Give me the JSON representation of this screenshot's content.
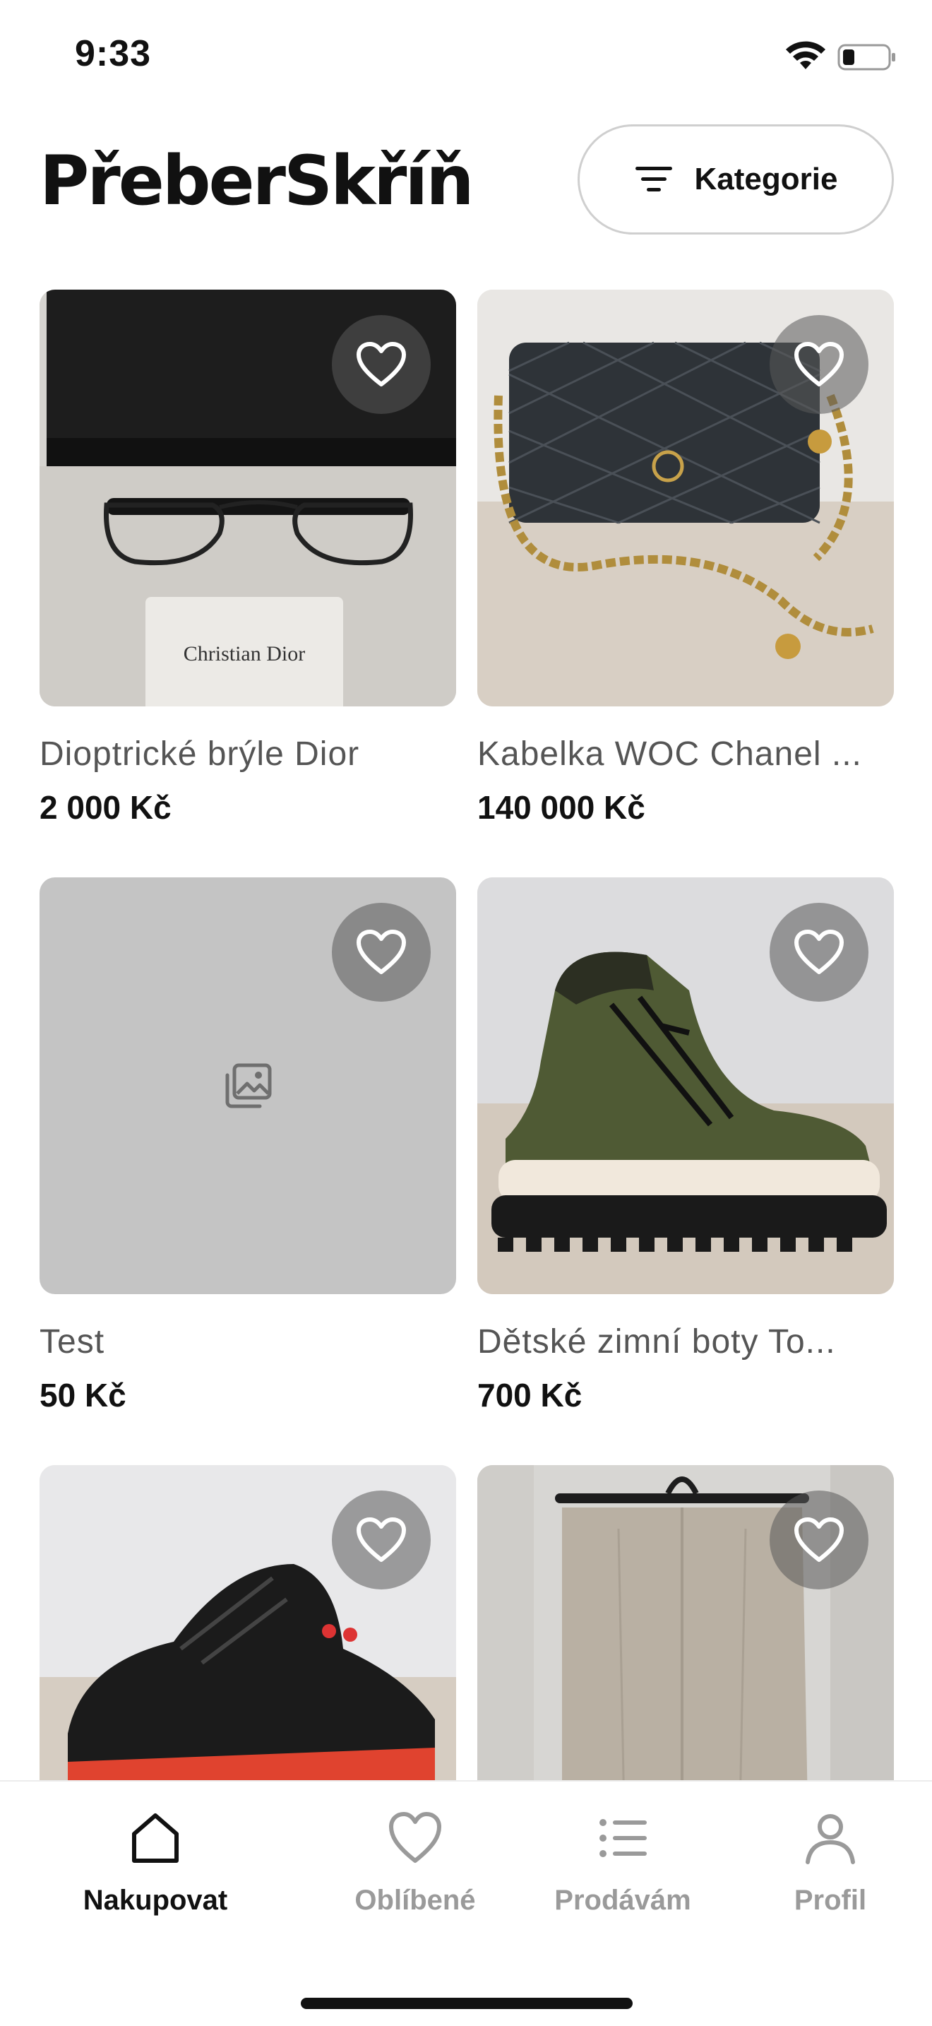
{
  "status_bar": {
    "time": "9:33",
    "wifi_icon": "wifi-icon",
    "battery_icon": "battery-low-icon"
  },
  "header": {
    "logo": "PřeberSkříň",
    "category_button": {
      "label": "Kategorie",
      "icon": "filter-icon"
    }
  },
  "products": [
    {
      "title": "Dioptrické brýle Dior",
      "price": "2 000 Kč",
      "image": "dior-glasses-photo"
    },
    {
      "title": "Kabelka WOC Chanel ...",
      "price": "140 000 Kč",
      "image": "chanel-bag-photo"
    },
    {
      "title": "Test",
      "price": "50 Kč",
      "image": "image-placeholder-icon"
    },
    {
      "title": "Dětské zimní boty To...",
      "price": "700 Kč",
      "image": "winter-boots-photo"
    },
    {
      "title": "",
      "price": "",
      "image": "sneakers-photo"
    },
    {
      "title": "",
      "price": "",
      "image": "trousers-photo"
    }
  ],
  "bottom_nav": {
    "items": [
      {
        "label": "Nakupovat",
        "icon": "home-icon",
        "active": true
      },
      {
        "label": "Oblíbené",
        "icon": "heart-icon",
        "active": false
      },
      {
        "label": "Prodávám",
        "icon": "list-icon",
        "active": false
      },
      {
        "label": "Profil",
        "icon": "user-icon",
        "active": false
      }
    ]
  },
  "colors": {
    "text": "#111111",
    "muted": "#9a9a9a",
    "placeholder_bg": "#c4c4c4",
    "fav_overlay": "#5a5a5a"
  }
}
